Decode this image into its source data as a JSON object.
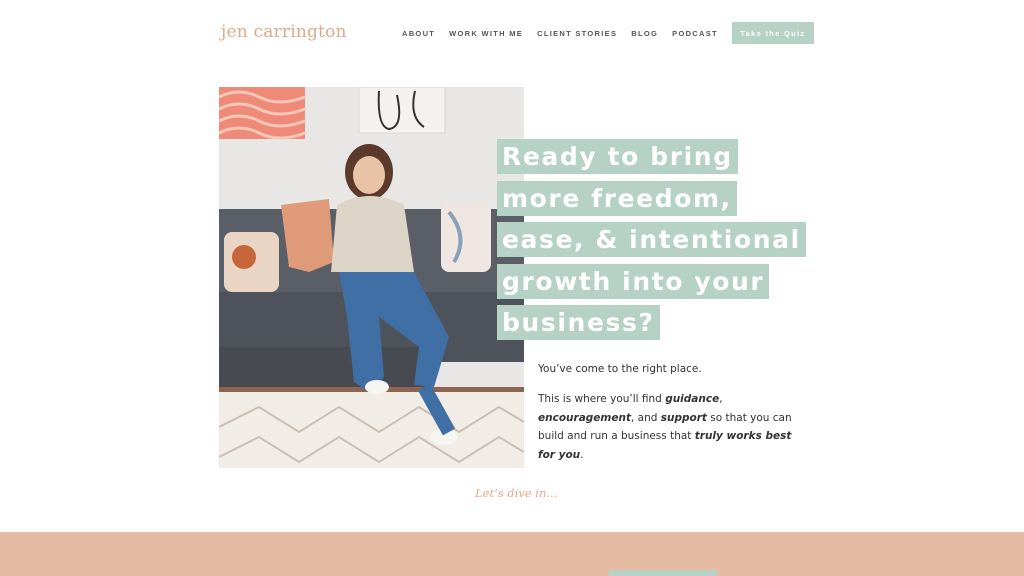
{
  "header": {
    "logo": "jen carrington",
    "nav": [
      "About",
      "Work with me",
      "Client Stories",
      "Blog",
      "Podcast"
    ],
    "cta": "Take the Quiz"
  },
  "hero": {
    "headline_lines": [
      "Ready to bring",
      "more freedom,",
      "ease, & intentional",
      "growth into your",
      "business?"
    ],
    "intro_1": "You’ve come to the right place.",
    "intro_2_a": "This is where you’ll find ",
    "intro_2_b": "guidance",
    "intro_2_c": ", ",
    "intro_2_d": "encouragement",
    "intro_2_e": ", and ",
    "intro_2_f": "support",
    "intro_2_g": " so that you can build and run a business that ",
    "intro_2_h": "truly works best for you",
    "intro_2_i": ".",
    "dive": "Let’s dive in..."
  },
  "colors": {
    "accent_mint": "#b6d1c6",
    "accent_peach": "#e6bba3",
    "logo": "#e0a98a"
  }
}
